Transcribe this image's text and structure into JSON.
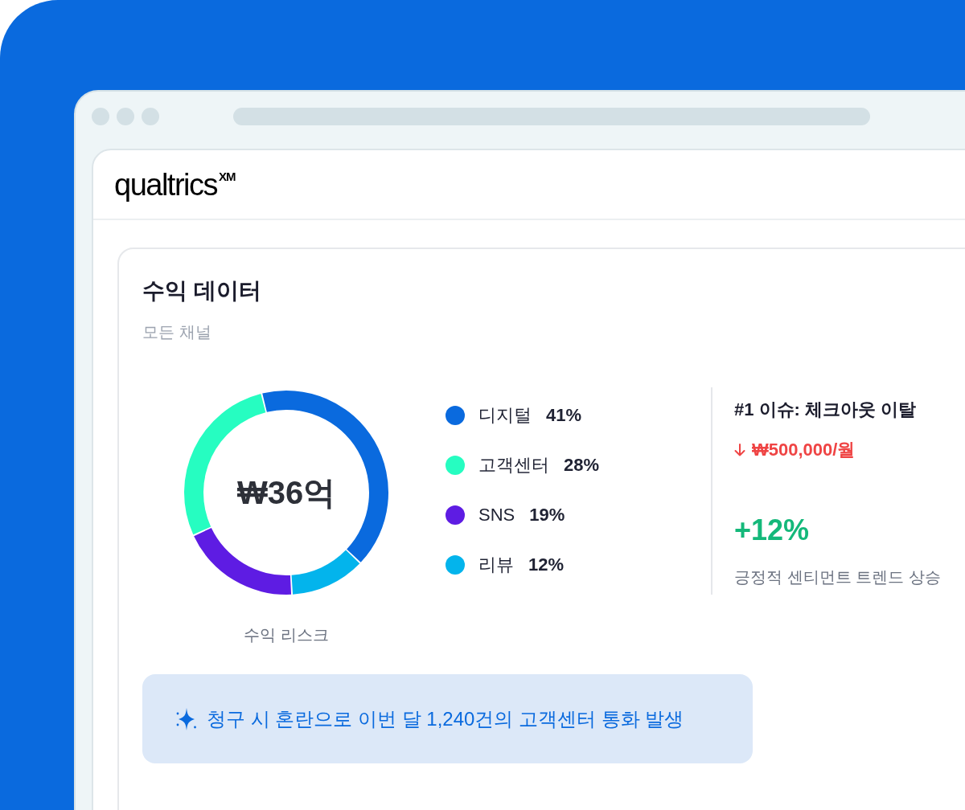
{
  "brand": {
    "logo": "qualtrics$^{XM}$"
  },
  "revenue_card": {
    "title": "수익 데이터",
    "subtitle": "모든 채널",
    "donut": {
      "center_value": "₩36억",
      "caption": "수익 리스크",
      "chart_data": {
        "type": "donut",
        "values": [
          41,
          28,
          19,
          12
        ]
      }
    },
    "legend": [
      {
        "label": "디지털",
        "value": "41%",
        "color": "#0a6ade"
      },
      {
        "label": "고객센터",
        "value": "28%",
        "color": "#26fdc1"
      },
      {
        "label": "SNS",
        "value": "19%",
        "color": "#5e1ce3"
      },
      {
        "label": "리뷰",
        "value": "12%",
        "color": "#03b4ec"
      }
    ],
    "issue": {
      "title": "#1 이슈: 체크아웃 이탈",
      "impact": "₩500,000/월"
    },
    "trend": {
      "value": "+12%",
      "caption": "긍정적 센티먼트 트렌드 상승"
    },
    "insight": {
      "text": "청구 시 혼란으로 이번 달 1,240건의 고객센터 통화 발생"
    }
  }
}
